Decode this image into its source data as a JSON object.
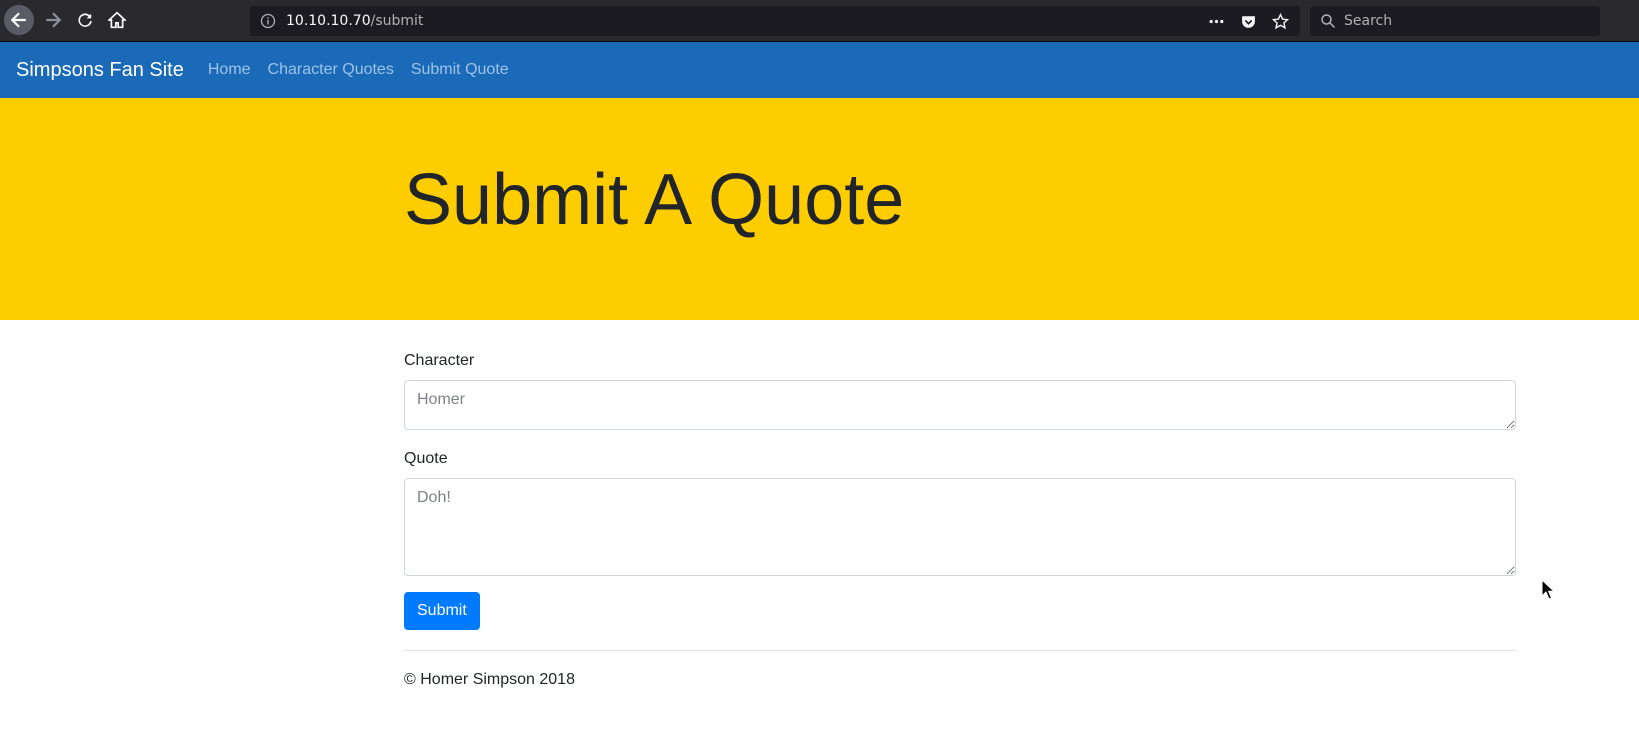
{
  "browser": {
    "url_host": "10.10.10.70",
    "url_path": "/submit",
    "search_placeholder": "Search"
  },
  "navbar": {
    "brand": "Simpsons Fan Site",
    "links": [
      {
        "label": "Home"
      },
      {
        "label": "Character Quotes"
      },
      {
        "label": "Submit Quote"
      }
    ]
  },
  "hero": {
    "title": "Submit A Quote"
  },
  "form": {
    "character_label": "Character",
    "character_placeholder": "Homer",
    "quote_label": "Quote",
    "quote_placeholder": "Doh!",
    "submit_label": "Submit"
  },
  "footer": {
    "text": "© Homer Simpson 2018"
  },
  "colors": {
    "navbar": "#1a6ab8",
    "hero": "#fecd00",
    "primary_button": "#007bff"
  }
}
